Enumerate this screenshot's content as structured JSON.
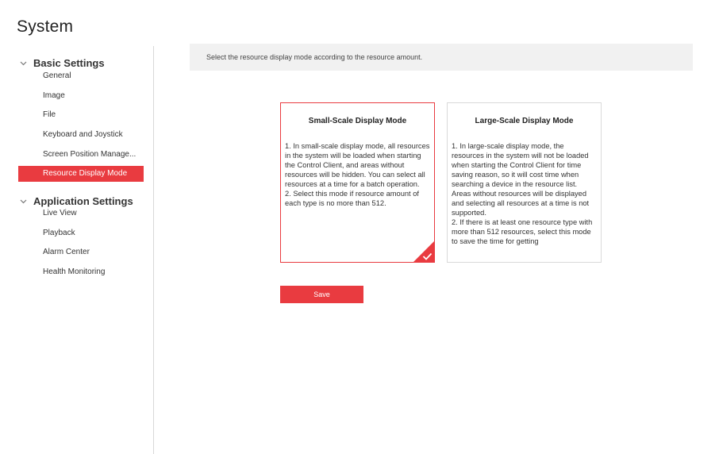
{
  "page": {
    "title": "System"
  },
  "sidebar": {
    "groups": [
      {
        "label": "Basic Settings",
        "items": [
          {
            "label": "General"
          },
          {
            "label": "Image"
          },
          {
            "label": "File"
          },
          {
            "label": "Keyboard and Joystick"
          },
          {
            "label": "Screen Position Manage..."
          },
          {
            "label": "Resource Display Mode",
            "active": true
          }
        ]
      },
      {
        "label": "Application Settings",
        "items": [
          {
            "label": "Live View"
          },
          {
            "label": "Playback"
          },
          {
            "label": "Alarm Center"
          },
          {
            "label": "Health Monitoring"
          }
        ]
      }
    ]
  },
  "main": {
    "hint": "Select the resource display mode according to the resource amount.",
    "modes": [
      {
        "title": "Small-Scale Display Mode",
        "selected": true,
        "description": "1. In small-scale display mode, all resources in the system will be loaded when starting the Control Client, and areas without resources will be hidden. You can select all resources at a time for a batch operation.\n2. Select this mode if resource amount of each type is no more than 512."
      },
      {
        "title": "Large-Scale Display Mode",
        "selected": false,
        "description": "1. In large-scale display mode, the resources in the system will not be loaded when starting the Control Client for time saving reason, so it will cost time when searching a device in the resource list. Areas without resources will be displayed and selecting all resources at a time is not supported.\n2. If there is at least one resource type with more than 512 resources, select this mode to save the time for getting"
      }
    ],
    "save_label": "Save"
  },
  "colors": {
    "accent": "#e93b40",
    "hint_bg": "#f1f1f1",
    "divider": "#d8d8d8"
  },
  "icons": {
    "group_toggle": "chevron-down-icon",
    "selected_mark": "checkmark-icon"
  }
}
